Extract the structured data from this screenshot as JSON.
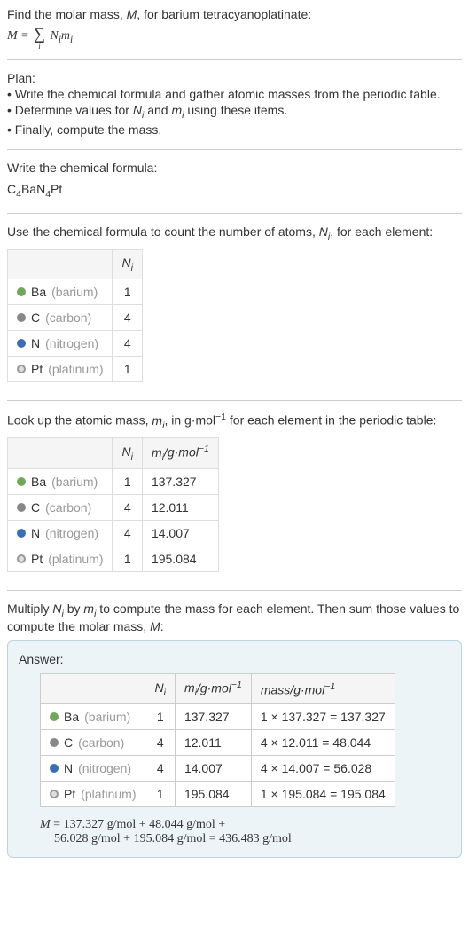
{
  "intro": {
    "line1": "Find the molar mass, M, for barium tetracyanoplatinate:",
    "formula": "M = ∑ Nᵢmᵢ",
    "sigma_sub": "i"
  },
  "plan": {
    "header": "Plan:",
    "items": [
      "• Write the chemical formula and gather atomic masses from the periodic table.",
      "• Determine values for Nᵢ and mᵢ using these items.",
      "• Finally, compute the mass."
    ]
  },
  "chemformula": {
    "header": "Write the chemical formula:",
    "formula_prefix": "C",
    "formula_c": "4",
    "formula_ba": "BaN",
    "formula_n": "4",
    "formula_pt": "Pt"
  },
  "table1": {
    "desc": "Use the chemical formula to count the number of atoms, Nᵢ, for each element:",
    "header_ni": "Nᵢ",
    "rows": [
      {
        "element": "Ba",
        "name": "(barium)",
        "ni": "1",
        "dot": "dot-ba"
      },
      {
        "element": "C",
        "name": "(carbon)",
        "ni": "4",
        "dot": "dot-c"
      },
      {
        "element": "N",
        "name": "(nitrogen)",
        "ni": "4",
        "dot": "dot-n"
      },
      {
        "element": "Pt",
        "name": "(platinum)",
        "ni": "1",
        "dot": "dot-pt"
      }
    ]
  },
  "table2": {
    "desc_prefix": "Look up the atomic mass, mᵢ, in g·mol",
    "desc_suffix": " for each element in the periodic table:",
    "header_ni": "Nᵢ",
    "header_mi": "mᵢ/g·mol⁻¹",
    "rows": [
      {
        "element": "Ba",
        "name": "(barium)",
        "ni": "1",
        "mi": "137.327",
        "dot": "dot-ba"
      },
      {
        "element": "C",
        "name": "(carbon)",
        "ni": "4",
        "mi": "12.011",
        "dot": "dot-c"
      },
      {
        "element": "N",
        "name": "(nitrogen)",
        "ni": "4",
        "mi": "14.007",
        "dot": "dot-n"
      },
      {
        "element": "Pt",
        "name": "(platinum)",
        "ni": "1",
        "mi": "195.084",
        "dot": "dot-pt"
      }
    ]
  },
  "answer": {
    "desc": "Multiply Nᵢ by mᵢ to compute the mass for each element. Then sum those values to compute the molar mass, M:",
    "header": "Answer:",
    "header_ni": "Nᵢ",
    "header_mi": "mᵢ/g·mol⁻¹",
    "header_mass": "mass/g·mol⁻¹",
    "rows": [
      {
        "element": "Ba",
        "name": "(barium)",
        "ni": "1",
        "mi": "137.327",
        "mass": "1 × 137.327 = 137.327",
        "dot": "dot-ba"
      },
      {
        "element": "C",
        "name": "(carbon)",
        "ni": "4",
        "mi": "12.011",
        "mass": "4 × 12.011 = 48.044",
        "dot": "dot-c"
      },
      {
        "element": "N",
        "name": "(nitrogen)",
        "ni": "4",
        "mi": "14.007",
        "mass": "4 × 14.007 = 56.028",
        "dot": "dot-n"
      },
      {
        "element": "Pt",
        "name": "(platinum)",
        "ni": "1",
        "mi": "195.084",
        "mass": "1 × 195.084 = 195.084",
        "dot": "dot-pt"
      }
    ],
    "formula_line1": "M = 137.327 g/mol + 48.044 g/mol +",
    "formula_line2": "56.028 g/mol + 195.084 g/mol = 436.483 g/mol"
  }
}
